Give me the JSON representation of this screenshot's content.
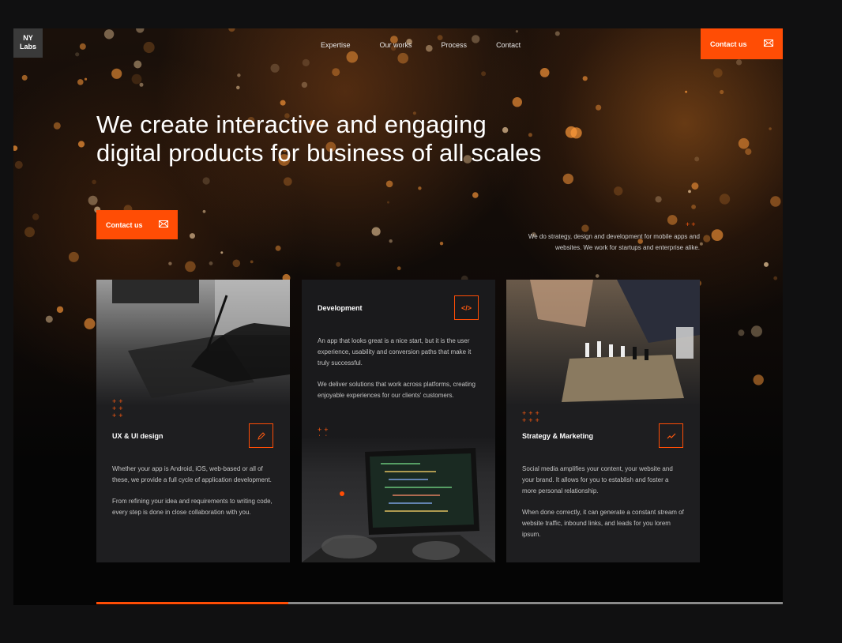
{
  "header": {
    "logo": "NY Labs",
    "logo_line1": "NY",
    "logo_line2": "Labs",
    "nav": [
      "Expertise",
      "Our works",
      "Process",
      "Contact"
    ],
    "cta_label": "Contact us"
  },
  "hero": {
    "title": "We create interactive and engaging digital products for business of all scales",
    "cta_label": "Contact us",
    "tagline": "We do strategy, design and development for mobile apps and websites. We work for startups and enterprise alike."
  },
  "cards": [
    {
      "title": "UX & UI design",
      "icon": "pencil-icon",
      "paragraphs": [
        "Whether your app is Android, iOS, web-based or all of these, we provide a full cycle of application development.",
        "From refining your idea and requirements to writing code, every step is done in close collaboration with you."
      ]
    },
    {
      "title": "Development",
      "icon": "code-icon",
      "icon_text": "</>",
      "paragraphs": [
        "An app that looks great is a nice start, but it is the user experience, usability and conversion paths that make it truly successful.",
        "We deliver solutions that work across platforms, creating enjoyable experiences for our clients' customers."
      ]
    },
    {
      "title": "Strategy & Marketing",
      "icon": "chart-trend-icon",
      "paragraphs": [
        "Social media amplifies your content, your website and your brand. It allows for you to establish and foster a more personal relationship.",
        "When done correctly, it can generate a constant stream of website traffic, inbound links, and leads for you lorem ipsum."
      ]
    }
  ],
  "progress": {
    "fraction": 0.28
  },
  "colors": {
    "accent": "#ff4d05",
    "background": "#101011",
    "card": "#1e1e20"
  }
}
